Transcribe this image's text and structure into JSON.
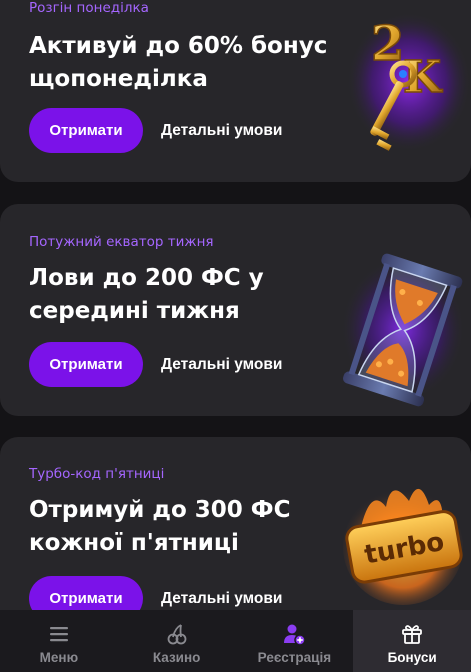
{
  "promos": [
    {
      "tag": "Розгін понеділка",
      "title": "Активуй до 60% бонус щопонеділка",
      "get_label": "Отримати",
      "details_label": "Детальні умови",
      "art_icon": "golden-key-icon"
    },
    {
      "tag": "Потужний екватор тижня",
      "title": "Лови до 200 ФС у середині тижня",
      "get_label": "Отримати",
      "details_label": "Детальні умови",
      "art_icon": "hourglass-icon"
    },
    {
      "tag": "Турбо-код п'ятниці",
      "title": "Отримуй до 300 ФС кожної п'ятниці",
      "get_label": "Отримати",
      "details_label": "Детальні умови",
      "art_icon": "turbo-fire-icon",
      "art_text": "turbo"
    }
  ],
  "nav": [
    {
      "label": "Меню",
      "icon": "hamburger-icon",
      "active": false
    },
    {
      "label": "Казино",
      "icon": "cherries-icon",
      "active": false
    },
    {
      "label": "Реєстрація",
      "icon": "add-user-icon",
      "active": false
    },
    {
      "label": "Бонуси",
      "icon": "gift-icon",
      "active": true
    }
  ],
  "colors": {
    "background": "#141316",
    "card": "#27262a",
    "accent": "#7b12e9",
    "tag": "#a566ff",
    "nav_bg": "#1b1a1e",
    "nav_active_bg": "#2e2c32"
  }
}
